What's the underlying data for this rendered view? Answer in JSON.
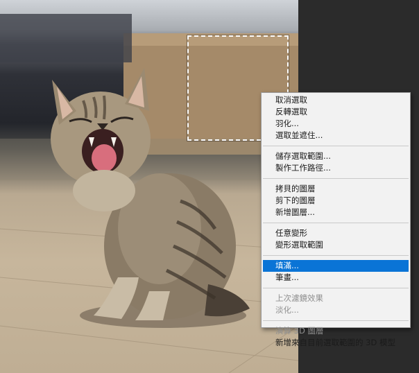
{
  "canvas": {
    "subject": "kitten-photo"
  },
  "context_menu": {
    "groups": [
      {
        "items": [
          {
            "label": "取消選取",
            "state": "enabled"
          },
          {
            "label": "反轉選取",
            "state": "enabled"
          },
          {
            "label": "羽化...",
            "state": "enabled"
          },
          {
            "label": "選取並遮住...",
            "state": "enabled"
          }
        ]
      },
      {
        "items": [
          {
            "label": "儲存選取範圍...",
            "state": "enabled"
          },
          {
            "label": "製作工作路徑...",
            "state": "enabled"
          }
        ]
      },
      {
        "items": [
          {
            "label": "拷貝的圖層",
            "state": "enabled"
          },
          {
            "label": "剪下的圖層",
            "state": "enabled"
          },
          {
            "label": "新增圖層...",
            "state": "enabled"
          }
        ]
      },
      {
        "items": [
          {
            "label": "任意變形",
            "state": "enabled"
          },
          {
            "label": "變形選取範圍",
            "state": "enabled"
          }
        ]
      },
      {
        "items": [
          {
            "label": "填滿...",
            "state": "active"
          },
          {
            "label": "筆畫...",
            "state": "enabled"
          }
        ]
      },
      {
        "items": [
          {
            "label": "上次濾鏡效果",
            "state": "disabled"
          },
          {
            "label": "淡化...",
            "state": "disabled"
          }
        ]
      },
      {
        "items": [
          {
            "label": "演算 3D 圖層",
            "state": "disabled"
          },
          {
            "label": "新增來自目前選取範圍的 3D 模型",
            "state": "enabled"
          }
        ]
      }
    ]
  },
  "colors": {
    "menu_highlight": "#0a74d6",
    "menu_background": "#f2f2f2",
    "workspace_background": "#2b2b2b"
  }
}
